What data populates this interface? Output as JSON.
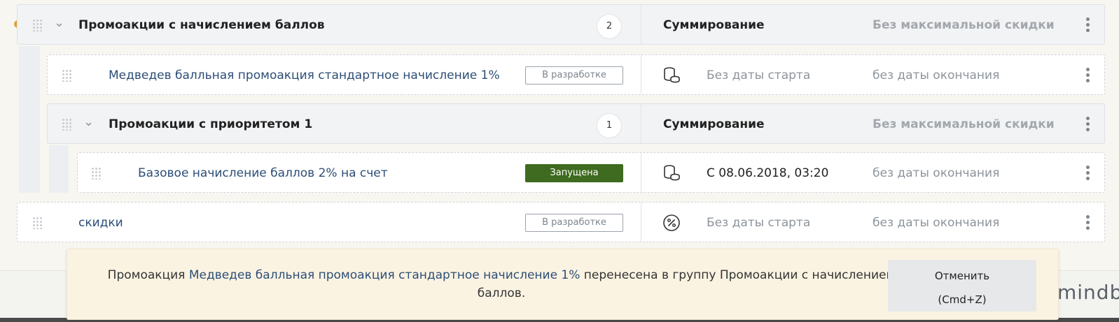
{
  "rows": [
    {
      "type": "group",
      "title": "Промоакции с начислением баллов",
      "count": "2",
      "col2": "Суммирование",
      "col3": "Без максимальной скидки"
    },
    {
      "type": "item",
      "title": "Медведев балльная промоакция стандартное начисление 1%",
      "status": "В разработке",
      "status_kind": "dev",
      "icon": "coins-icon",
      "col2": "Без даты старта",
      "col3": "без даты окончания"
    },
    {
      "type": "group",
      "title": "Промоакции с приоритетом 1",
      "count": "1",
      "col2": "Суммирование",
      "col3": "Без максимальной скидки"
    },
    {
      "type": "item",
      "title": "Базовое начисление баллов 2% на счет",
      "status": "Запущена",
      "status_kind": "run",
      "icon": "coins-icon",
      "col2": "С 08.06.2018, 03:20",
      "col3": "без даты окончания"
    },
    {
      "type": "item",
      "title": "скидки",
      "status": "В разработке",
      "status_kind": "dev",
      "icon": "percent-icon",
      "col2": "Без даты старта",
      "col3": "без даты окончания"
    }
  ],
  "toast": {
    "prefix": "Промоакция ",
    "link": "Медведев балльная промоакция стандартное начисление 1%",
    "suffix": " перенесена в группу Промоакции с начислением баллов.",
    "undo_label": "Отменить",
    "undo_shortcut": "(Cmd+Z)"
  },
  "brand": "mindb",
  "colors": {
    "running": "#3e6b1f",
    "link": "#2c4e76",
    "indicator": "#e3a23b"
  }
}
